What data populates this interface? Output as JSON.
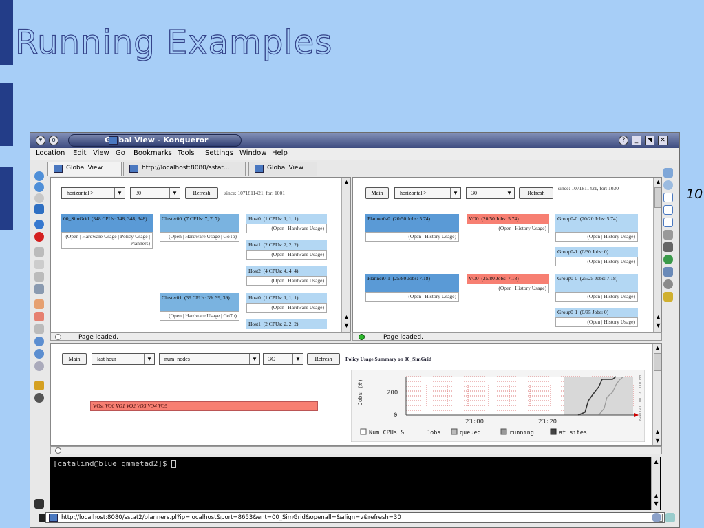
{
  "slide": {
    "title": "Running Examples",
    "page_number": "10"
  },
  "window": {
    "title": "Global View - Konqueror",
    "menu": [
      "Location",
      "Edit",
      "View",
      "Go",
      "Bookmarks",
      "Tools",
      "Settings",
      "Window",
      "Help"
    ],
    "tabs": [
      "Global View",
      "http://localhost:8080/sstat...",
      "Global View"
    ],
    "status_left": "Page loaded.",
    "status_right": "Page loaded."
  },
  "left_frame": {
    "orientation": "horizontal >",
    "interval": "30",
    "refresh": "Refresh",
    "since": "since: 1071811421, for: 1001",
    "grid": {
      "name": "00_SimGrid",
      "info": "(348 CPUs: 348, 348, 348)",
      "links": "(Open | Hardware Usage | Policy Usage | Planners)"
    },
    "clusters": [
      {
        "name": "Cluster00",
        "info": "(7 CPUs: 7, 7, 7)",
        "links": "(Open | Hardware Usage | GoTo)"
      },
      {
        "name": "Cluster01",
        "info": "(39 CPUs: 39, 39, 39)",
        "links": "(Open | Hardware Usage | GoTo)"
      }
    ],
    "hosts": [
      {
        "name": "Host0",
        "info": "(1 CPUs: 1, 1, 1)",
        "links": "(Open | Hardware Usage)"
      },
      {
        "name": "Host1",
        "info": "(2 CPUs: 2, 2, 2)",
        "links": "(Open | Hardware Usage)"
      },
      {
        "name": "Host2",
        "info": "(4 CPUs: 4, 4, 4)",
        "links": "(Open | Hardware Usage)"
      },
      {
        "name": "Host0",
        "info": "(1 CPUs: 1, 1, 1)",
        "links": "(Open | Hardware Usage)"
      },
      {
        "name": "Host1",
        "info": "(2 CPUs: 2, 2, 2)",
        "links": ""
      }
    ]
  },
  "right_frame": {
    "main": "Main",
    "orientation": "horizontal >",
    "interval": "30",
    "refresh": "Refresh",
    "since": "since: 1071811421, for: 1030",
    "planners": [
      {
        "name": "Planner0-0",
        "info": "(20/50 Jobs: 5.74)",
        "links": "(Open | History Usage)"
      },
      {
        "name": "Planner0-1",
        "info": "(25/80 Jobs: 7.18)",
        "links": "(Open | History Usage)"
      }
    ],
    "vos": [
      {
        "name": "VO0",
        "info": "(20/50 Jobs: 5.74)",
        "links": "(Open | History Usage)"
      },
      {
        "name": "VO0",
        "info": "(25/80 Jobs: 7.18)",
        "links": "(Open | History Usage)"
      }
    ],
    "groups": [
      {
        "name": "Group0-0",
        "info": "(20/20 Jobs: 5.74)",
        "links": "(Open | History Usage)"
      },
      {
        "name": "Group0-1",
        "info": "(0/30 Jobs: 0)",
        "links": "(Open | History Usage)"
      },
      {
        "name": "Group0-0",
        "info": "(25/25 Jobs: 7.18)",
        "links": "(Open | History Usage)"
      },
      {
        "name": "Group0-1",
        "info": "(0/35 Jobs: 0)",
        "links": "(Open | History Usage)"
      }
    ]
  },
  "bottom_frame": {
    "main": "Main",
    "range": "last hour",
    "metric": "num_nodes",
    "size": "3C",
    "refresh": "Refresh",
    "heading": "Policy Usage Summary on 00_SimGrid",
    "vos_label": "VOs:",
    "vos_list": "VO0 VO1 VO2 VO3 VO4 VO5"
  },
  "chart_data": {
    "type": "line",
    "ylabel": "Jobs (#)",
    "yticks": [
      0,
      200
    ],
    "xticks": [
      "23:00",
      "23:20"
    ],
    "side_label": "RRDTOOL / TOBI OETIKER",
    "legend": [
      "Num CPUs &",
      "Jobs",
      "queued",
      "running",
      "at sites"
    ],
    "legend_colors": [
      "#ffffff",
      "#ffffff",
      "#bbbbbb",
      "#999999",
      "#444444"
    ]
  },
  "terminal": {
    "prompt": "[catalind@blue gmmetad2]$ "
  },
  "location_url": "http://localhost:8080/sstat2/planners.pl?ip=localhost&port=8653&ent=00_SimGrid&openall=&align=v&refresh=30"
}
